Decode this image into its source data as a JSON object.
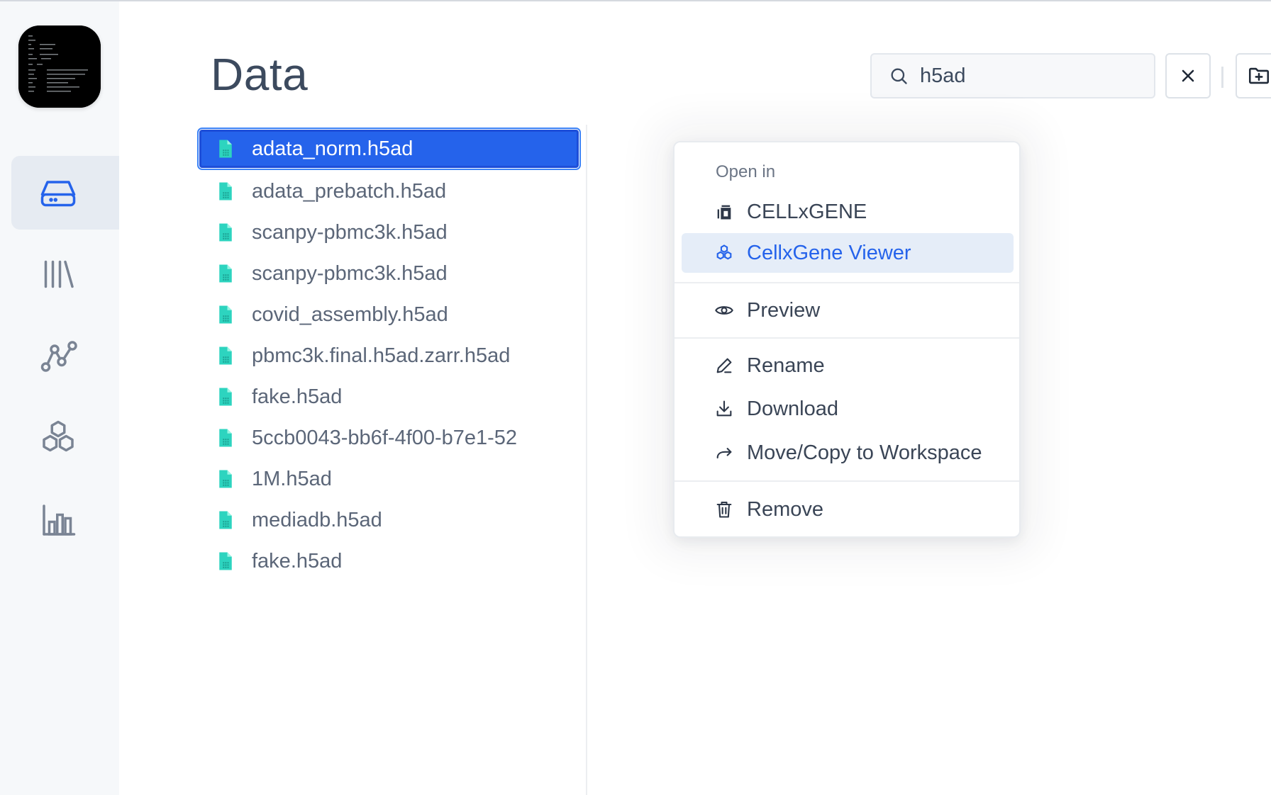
{
  "page": {
    "title": "Data"
  },
  "search": {
    "value": "h5ad"
  },
  "sidebar": {
    "items": [
      {
        "icon": "drive-icon",
        "active": true
      },
      {
        "icon": "library-icon",
        "active": false
      },
      {
        "icon": "workflow-icon",
        "active": false
      },
      {
        "icon": "hexagons-icon",
        "active": false
      },
      {
        "icon": "bar-chart-icon",
        "active": false
      }
    ]
  },
  "files": [
    {
      "name": "adata_norm.h5ad",
      "selected": true
    },
    {
      "name": "adata_prebatch.h5ad"
    },
    {
      "name": "scanpy-pbmc3k.h5ad"
    },
    {
      "name": "scanpy-pbmc3k.h5ad"
    },
    {
      "name": "covid_assembly.h5ad"
    },
    {
      "name": "pbmc3k.final.h5ad.zarr.h5ad"
    },
    {
      "name": "fake.h5ad"
    },
    {
      "name": "5ccb0043-bb6f-4f00-b7e1-52"
    },
    {
      "name": "1M.h5ad"
    },
    {
      "name": "mediadb.h5ad"
    },
    {
      "name": "fake.h5ad"
    }
  ],
  "context_menu": {
    "section_label": "Open in",
    "items": {
      "cellxgene": "CELLxGENE",
      "cellxgene_viewer": "CellxGene Viewer",
      "preview": "Preview",
      "rename": "Rename",
      "download": "Download",
      "move_copy": "Move/Copy to Workspace",
      "remove": "Remove"
    }
  },
  "colors": {
    "accent": "#2563eb",
    "file_icon": "#2dd4bf",
    "highlight_bg": "#e5edf8",
    "sidebar_bg": "#f6f8fa"
  }
}
